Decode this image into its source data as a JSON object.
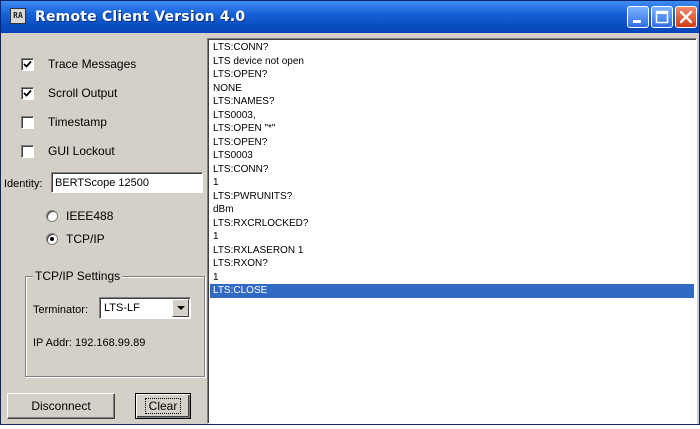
{
  "window": {
    "title": "Remote Client Version 4.0",
    "icon": "app-icon",
    "icon_text": "RA"
  },
  "options": {
    "checkboxes": [
      {
        "label": "Trace Messages",
        "checked": true
      },
      {
        "label": "Scroll Output",
        "checked": true
      },
      {
        "label": "Timestamp",
        "checked": false
      },
      {
        "label": "GUI Lockout",
        "checked": false
      }
    ]
  },
  "identity": {
    "label": "Identity:",
    "value": "BERTScope 12500"
  },
  "interface": {
    "options": [
      {
        "label": "IEEE488",
        "selected": false
      },
      {
        "label": "TCP/IP",
        "selected": true
      }
    ]
  },
  "tcpip": {
    "group_title": "TCP/IP Settings",
    "terminator_label": "Terminator:",
    "terminator_value": "LTS-LF",
    "ip_addr": "IP Addr: 192.168.99.89"
  },
  "buttons": {
    "disconnect": "Disconnect",
    "clear": "Clear"
  },
  "log": {
    "lines": [
      "LTS:CONN?",
      "LTS device not open",
      "LTS:OPEN?",
      "NONE",
      "LTS:NAMES?",
      "LTS0003,",
      "LTS:OPEN \"*\"",
      "LTS:OPEN?",
      "LTS0003",
      "LTS:CONN?",
      "1",
      "LTS:PWRUNITS?",
      "dBm",
      "LTS:RXCRLOCKED?",
      "1",
      "LTS:RXLASERON 1",
      "LTS:RXON?",
      "1",
      "LTS:CLOSE"
    ],
    "selected_index": 18
  },
  "colors": {
    "titlebar": "#0a4fc4",
    "selection": "#316ac5",
    "face": "#d4d0c8"
  }
}
